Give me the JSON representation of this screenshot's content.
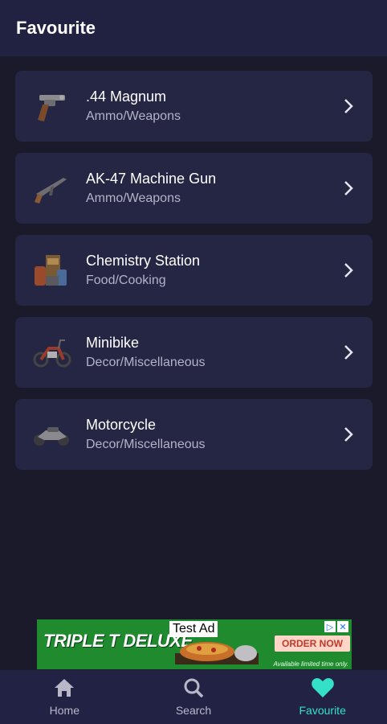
{
  "appbar": {
    "title": "Favourite"
  },
  "items": [
    {
      "title": ".44 Magnum",
      "category": "Ammo/Weapons",
      "icon": "revolver-icon"
    },
    {
      "title": "AK-47 Machine Gun",
      "category": "Ammo/Weapons",
      "icon": "rifle-icon"
    },
    {
      "title": "Chemistry Station",
      "category": "Food/Cooking",
      "icon": "chemistry-station-icon"
    },
    {
      "title": "Minibike",
      "category": "Decor/Miscellaneous",
      "icon": "minibike-icon"
    },
    {
      "title": "Motorcycle",
      "category": "Decor/Miscellaneous",
      "icon": "motorcycle-icon"
    }
  ],
  "ad": {
    "label": "Test Ad",
    "brand": "TRIPLE T DELUXE",
    "cta": "ORDER NOW",
    "fineprint": "Available limited time only."
  },
  "nav": {
    "home": "Home",
    "search": "Search",
    "favourite": "Favourite",
    "active": "favourite",
    "active_color": "#34e0c7"
  }
}
